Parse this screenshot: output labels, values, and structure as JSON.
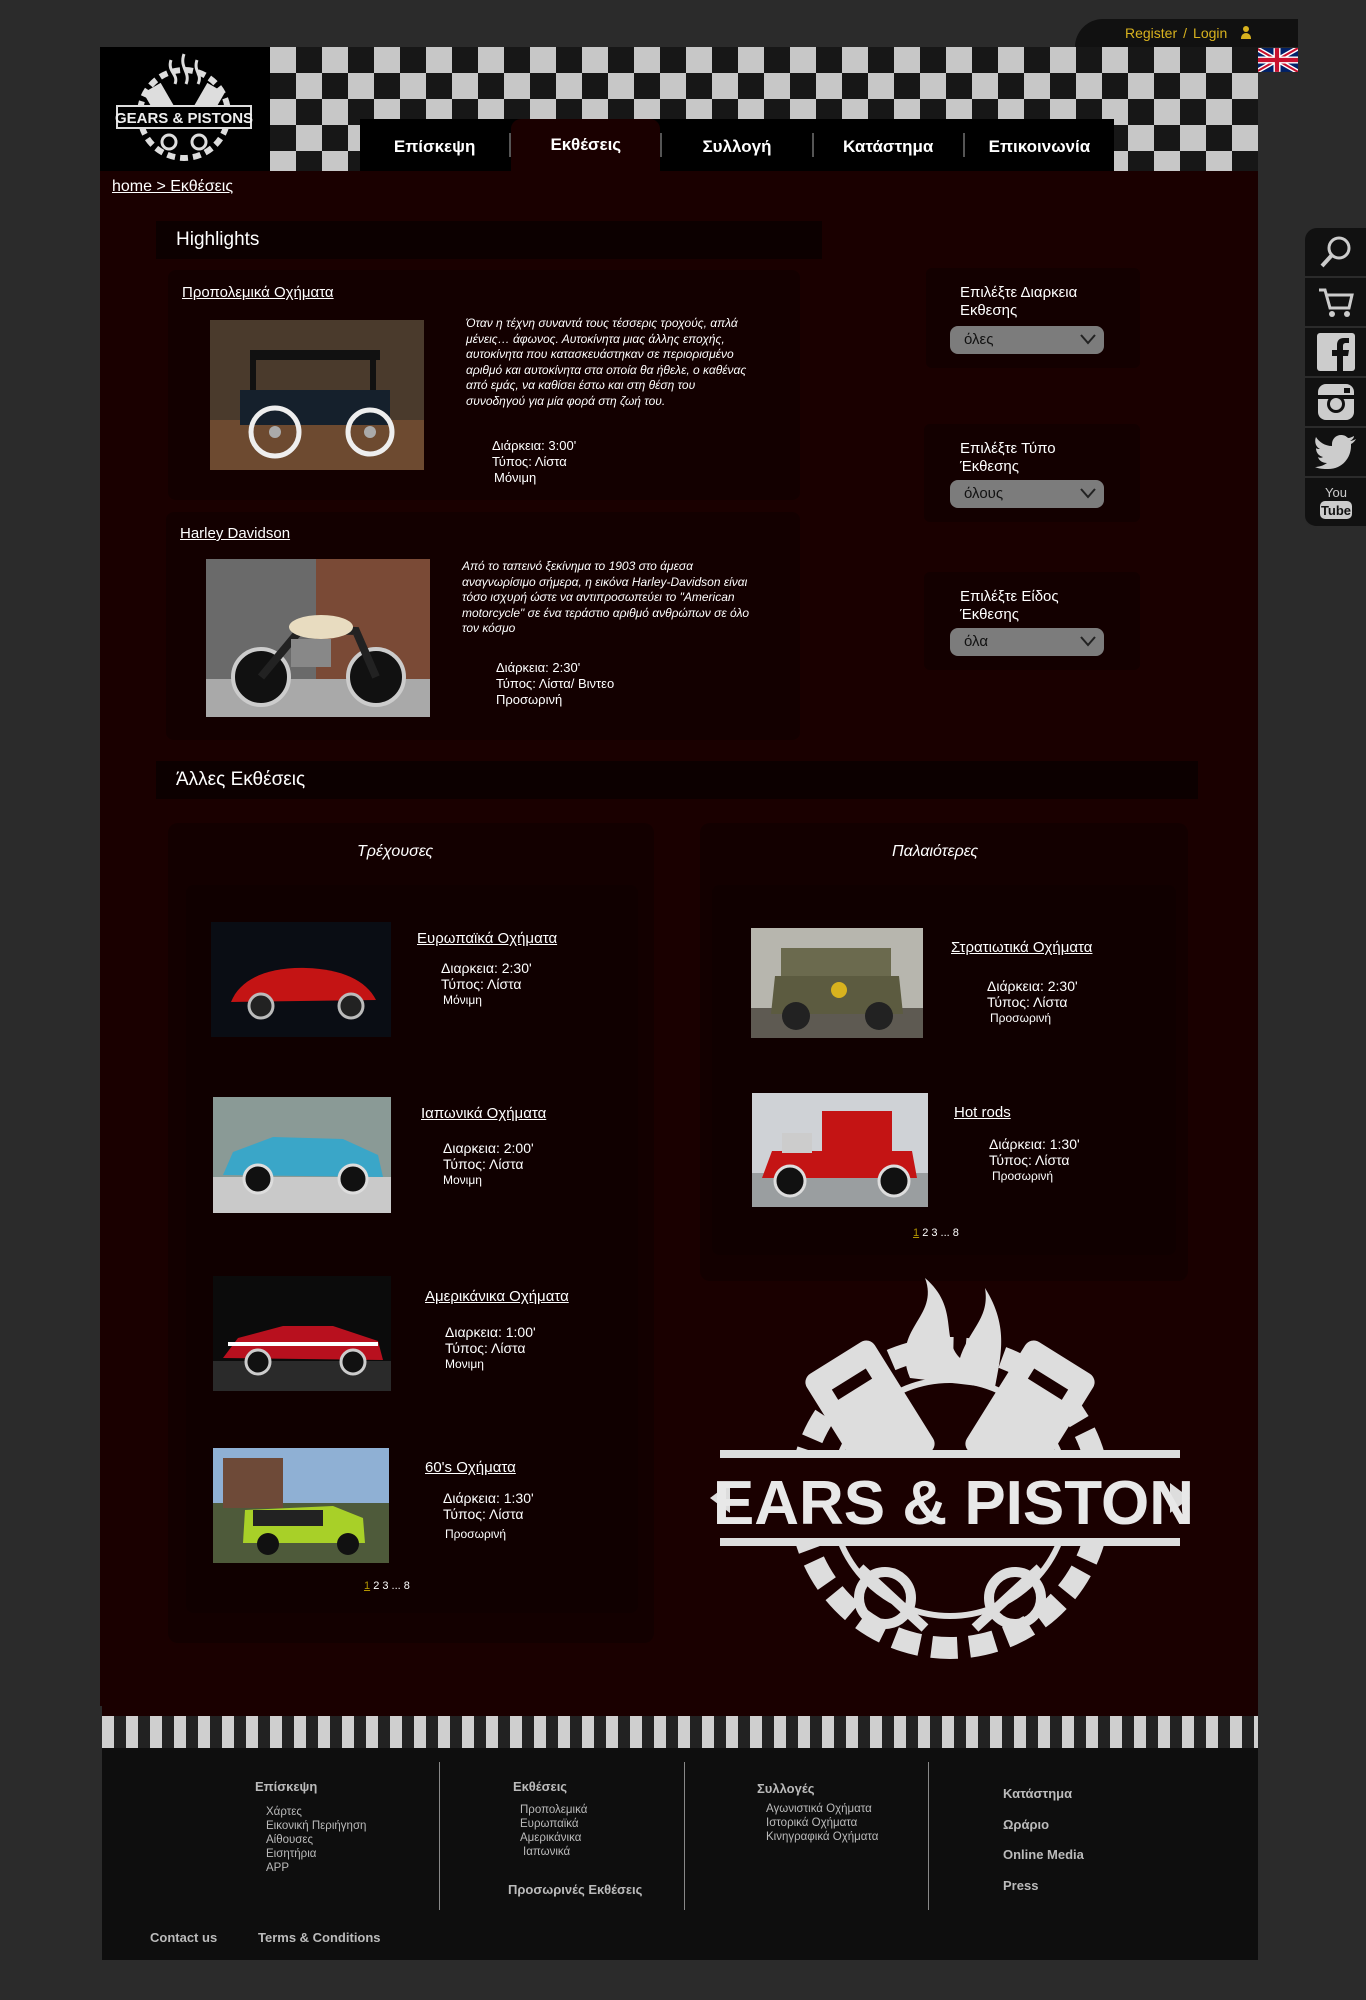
{
  "topbar": {
    "register": "Register",
    "separator": "/",
    "login": "Login"
  },
  "brand": {
    "logo_text": "GEARS & PISTONS"
  },
  "nav": [
    {
      "label": "Επίσκεψη"
    },
    {
      "label": "Εκθέσεις"
    },
    {
      "label": "Συλλογή"
    },
    {
      "label": "Κατάστημα"
    },
    {
      "label": "Επικοινωνία"
    }
  ],
  "breadcrumb": "home > Εκθέσεις",
  "highlights": {
    "heading": "Highlights",
    "items": [
      {
        "title": "Προπολεμικά Οχήματα",
        "description": "Όταν η τέχνη συναντά τους τέσσερις τροχούς, απλά μένεις… άφωνος. Αυτοκίνητα μιας άλλης εποχής, αυτοκίνητα που κατασκευάστηκαν σε περιορισμένο αριθμό και αυτοκίνητα στα οποία θα ήθελε,  ο καθένας από εμάς,  να καθίσει έστω και στη θέση του συνοδηγού για  μία φορά στη ζωή του.",
        "duration": "Διάρκεια: 3:00'",
        "type": "Τύπος: Λίστα",
        "status": "Μόνιμη"
      },
      {
        "title": "Harley Davidson",
        "description": "Από το ταπεινό ξεκίνημα το 1903 στο άμεσα αναγνωρίσιμο σήμερα, η εικόνα Harley-Davidson είναι τόσο ισχυρή ώστε να αντιπροσωπεύει το \"American motorcycle\" σε ένα τεράστιο αριθμό ανθρώπων σε όλο τον κόσμο",
        "duration": "Διάρκεια: 2:30'",
        "type": "Τύπος: Λίστα/ Βιντεο",
        "status": "Προσωρινή"
      }
    ]
  },
  "filters": [
    {
      "label": "Επιλέξτε Διαρκεια Εκθεσης",
      "value": "όλες"
    },
    {
      "label": "Επιλέξτε Τύπο Έκθεσης",
      "value": "όλους"
    },
    {
      "label": "Επιλέξτε Είδος Έκθεσης",
      "value": "όλα"
    }
  ],
  "others": {
    "heading": "Άλλες Εκθέσεις",
    "current": {
      "title": "Τρέχουσες",
      "items": [
        {
          "title": "Ευρωπαϊκά Οχήματα",
          "duration": "Διαρκεια:  2:30'",
          "type": "Τύπος: Λίστα",
          "status": "Μόνιμη"
        },
        {
          "title": "Ιαπωνικά Οχήματα",
          "duration": "Διαρκεια: 2:00'",
          "type": "Τύπος: Λίστα",
          "status": "Μονιμη"
        },
        {
          "title": "Αμερικάνικα Οχήματα",
          "duration": "Διαρκεια: 1:00'",
          "type": "Τύπος: Λίστα",
          "status": "Μονιμη"
        },
        {
          "title": "60's Οχήματα",
          "duration": "Διάρκεια: 1:30'",
          "type": "Τύπος: Λίστα",
          "status": "Προσωρινή"
        }
      ],
      "pager": {
        "current": "1",
        "rest": "2  3 ... 8"
      }
    },
    "older": {
      "title": "Παλαιότερες",
      "items": [
        {
          "title": "Στρατιωτικά Οχήματα",
          "duration": "Διάρκεια: 2:30'",
          "type": "Τύπος: Λίστα",
          "status": "Προσωρινή"
        },
        {
          "title": "Hot rods",
          "duration": "Διάρκεια: 1:30'",
          "type": "Τύπος: Λίστα",
          "status": "Προσωρινή"
        }
      ],
      "pager": {
        "current": "1",
        "rest": "2  3 ... 8"
      }
    }
  },
  "footer": {
    "col1": {
      "title": "Επίσκεψη",
      "items": [
        "Χάρτες",
        "Εικονική Περιήγηση",
        "Αίθουσες",
        "Εισητήρια",
        "APP"
      ]
    },
    "col2": {
      "title": "Εκθέσεις",
      "items": [
        "Προπολεμικά",
        "Ευρωπαϊκά",
        "Αμερικάνικα",
        "Ιαπωνικά"
      ],
      "extra": "Προσωρινές Εκθέσεις"
    },
    "col3": {
      "title": "Συλλογές",
      "items": [
        "Αγωνιστικά Οχήματα",
        "Ιστορικά Οχήματα",
        "Κινηγραφικά Οχήματα"
      ]
    },
    "col4": {
      "items": [
        "Κατάστημα",
        "Ωράριο",
        "Online Media",
        "Press"
      ]
    },
    "contact": "Contact us",
    "terms": "Terms & Conditions"
  },
  "side_icons": [
    "search-icon",
    "cart-icon",
    "facebook-icon",
    "instagram-icon",
    "twitter-icon",
    "youtube-icon"
  ],
  "youtube_label": {
    "you": "You",
    "tube": "Tube"
  },
  "colors": {
    "panel": "#1a0000",
    "accent": "#d8b21e",
    "page_bg": "#2b2b2b"
  }
}
